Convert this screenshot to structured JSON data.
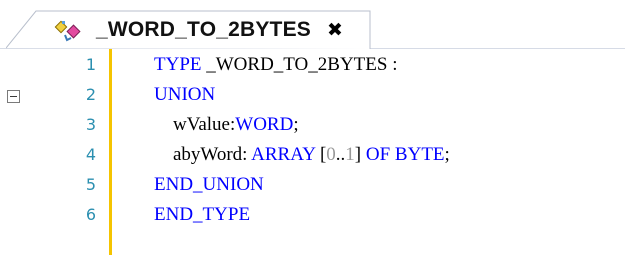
{
  "tab": {
    "title": "_WORD_TO_2BYTES",
    "close_glyph": "✖",
    "icon": "dut-union-icon"
  },
  "editor": {
    "line_numbers": [
      "1",
      "2",
      "3",
      "4",
      "5",
      "6"
    ],
    "lines": [
      [
        {
          "t": "TYPE",
          "kind": "kw"
        },
        {
          "t": " _WORD_TO_2BYTES :",
          "kind": "plain"
        }
      ],
      [
        {
          "t": "UNION",
          "kind": "kw"
        }
      ],
      [
        {
          "t": "    wValue:",
          "kind": "plain"
        },
        {
          "t": "WORD",
          "kind": "kw"
        },
        {
          "t": ";",
          "kind": "plain"
        }
      ],
      [
        {
          "t": "    abyWord: ",
          "kind": "plain"
        },
        {
          "t": "ARRAY",
          "kind": "kw"
        },
        {
          "t": " [",
          "kind": "plain"
        },
        {
          "t": "0",
          "kind": "num"
        },
        {
          "t": "..",
          "kind": "plain"
        },
        {
          "t": "1",
          "kind": "num"
        },
        {
          "t": "] ",
          "kind": "plain"
        },
        {
          "t": "OF",
          "kind": "kw"
        },
        {
          "t": " ",
          "kind": "plain"
        },
        {
          "t": "BYTE",
          "kind": "kw"
        },
        {
          "t": ";",
          "kind": "plain"
        }
      ],
      [
        {
          "t": "END_UNION",
          "kind": "kw"
        }
      ],
      [
        {
          "t": "END_TYPE",
          "kind": "kw"
        }
      ]
    ]
  },
  "colors": {
    "keyword": "#0000ff",
    "number": "#999999",
    "line_number": "#2b8fb0",
    "gutter_marker": "#f5c400"
  }
}
